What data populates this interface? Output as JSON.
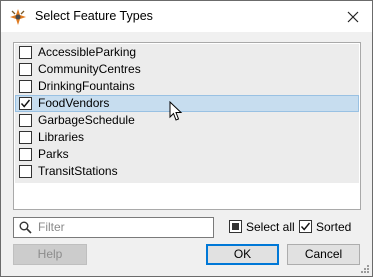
{
  "window": {
    "title": "Select Feature Types",
    "app_icon": "fme-workbench-icon",
    "close_icon": "close-icon"
  },
  "feature_types": [
    {
      "label": "AccessibleParking",
      "checked": false,
      "selected": false
    },
    {
      "label": "CommunityCentres",
      "checked": false,
      "selected": false
    },
    {
      "label": "DrinkingFountains",
      "checked": false,
      "selected": false
    },
    {
      "label": "FoodVendors",
      "checked": true,
      "selected": true
    },
    {
      "label": "GarbageSchedule",
      "checked": false,
      "selected": false
    },
    {
      "label": "Libraries",
      "checked": false,
      "selected": false
    },
    {
      "label": "Parks",
      "checked": false,
      "selected": false
    },
    {
      "label": "TransitStations",
      "checked": false,
      "selected": false
    }
  ],
  "filter": {
    "placeholder": "Filter",
    "value": "",
    "icon": "search-icon"
  },
  "options": {
    "select_all_label": "Select all",
    "select_all_state": "indeterminate",
    "sorted_label": "Sorted",
    "sorted_checked": true
  },
  "buttons": {
    "help": "Help",
    "ok": "OK",
    "cancel": "Cancel"
  },
  "colors": {
    "selected_row": "#c7ddef",
    "default_button_border": "#0078d7",
    "list_background": "#ececec"
  }
}
